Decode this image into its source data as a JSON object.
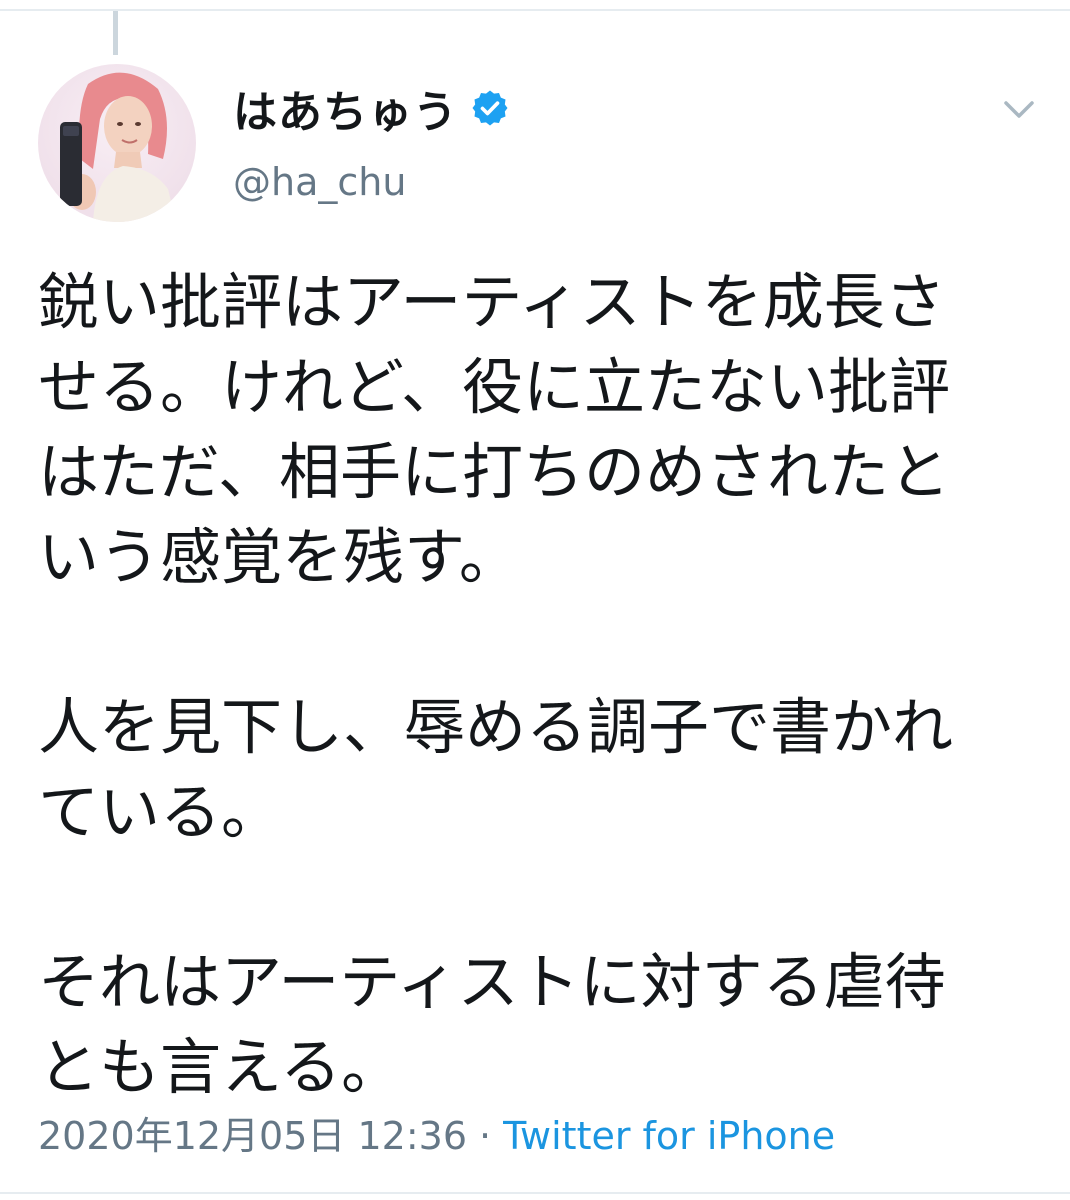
{
  "tweet": {
    "author": {
      "display_name": "はあちゅう",
      "handle": "@ha_chu",
      "verified": true,
      "verified_icon": "verified-badge-icon",
      "avatar": "profile-avatar"
    },
    "menu_icon": "chevron-down-icon",
    "text_lines": [
      "鋭い批評はアーティストを成長さ",
      "せる。けれど、役に立たない批評",
      "はただ、相手に打ちのめされたと",
      "いう感覚を残す。"
    ],
    "text_lines_2": [
      "人を見下し、辱める調子で書かれ",
      "ている。"
    ],
    "text_lines_3": [
      "それはアーティストに対する虐待",
      "とも言える。"
    ],
    "timestamp": "2020年12月05日 12:36",
    "separator": "·",
    "source": "Twitter for iPhone"
  },
  "colors": {
    "text": "#14171a",
    "secondary": "#657786",
    "link": "#1b95e0",
    "verified": "#1da1f2",
    "border": "#e6ecf0"
  }
}
